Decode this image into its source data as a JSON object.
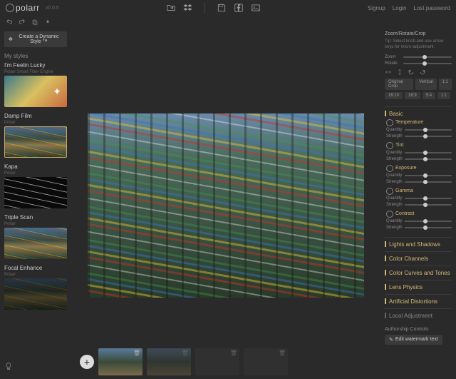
{
  "app": {
    "name": "polarr",
    "version": "v0.0.5"
  },
  "header": {
    "links": {
      "signup": "Signup",
      "login": "Login",
      "lost_password": "Lost password"
    }
  },
  "toolbar": {
    "dynamic_style": "Create a Dynamic Style ™"
  },
  "styles": {
    "section": "My styles",
    "items": [
      {
        "name": "I'm Feelin Lucky",
        "sub": "Polarr Smart Filter Engine"
      },
      {
        "name": "Damp Film",
        "sub": "Polarr"
      },
      {
        "name": "Kapa",
        "sub": "Polarr"
      },
      {
        "name": "Triple Scan",
        "sub": "Polarr"
      },
      {
        "name": "Focal Enhance",
        "sub": "Polarr"
      }
    ]
  },
  "crop": {
    "title": "Zoom/Rotate/Crop",
    "tip": "Tip: Select knob and use arrow keys for micro-adjustment",
    "zoom": "Zoom",
    "rotate": "Rotate",
    "presets1": [
      "Original Crop",
      "Vertical",
      "1:1"
    ],
    "presets2": [
      "16:10",
      "16:9",
      "5:4",
      "1:1"
    ]
  },
  "panels": {
    "basic": "Basic",
    "lights": "Lights and Shadows",
    "channels": "Color Channels",
    "curves": "Color Curves and Tones",
    "lens": "Lens Physics",
    "distort": "Artificial Distortions",
    "local": "Local Adjustment"
  },
  "params": {
    "temperature": "Temperature",
    "tint": "Tint",
    "exposure": "Exposure",
    "gamma": "Gamma",
    "contrast": "Contrast",
    "quantity": "Quantity",
    "strength": "Strength"
  },
  "authorship": {
    "label": "Authorship Controls",
    "watermark": "Edit watermark text"
  }
}
